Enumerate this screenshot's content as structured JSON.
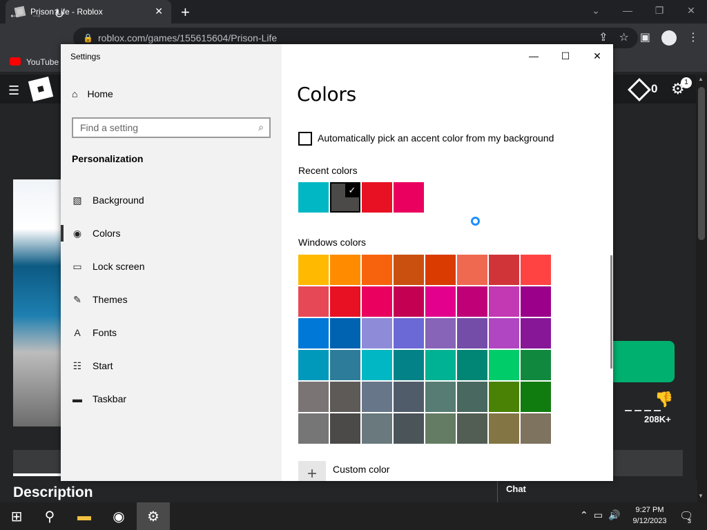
{
  "browser": {
    "tab_title": "Prison Life - Roblox",
    "url": "roblox.com/games/155615604/Prison-Life",
    "bookmark": "YouTube"
  },
  "roblox": {
    "robux": "0",
    "notifications": "1",
    "votes": "208K+",
    "section_title": "Description",
    "chat_label": "Chat"
  },
  "settings": {
    "window_title": "Settings",
    "home_label": "Home",
    "search_placeholder": "Find a setting",
    "section_label": "Personalization",
    "nav_items": [
      {
        "label": "Background",
        "icon": "picture-icon"
      },
      {
        "label": "Colors",
        "icon": "palette-icon"
      },
      {
        "label": "Lock screen",
        "icon": "lock-screen-icon"
      },
      {
        "label": "Themes",
        "icon": "brush-icon"
      },
      {
        "label": "Fonts",
        "icon": "fonts-icon"
      },
      {
        "label": "Start",
        "icon": "start-icon"
      },
      {
        "label": "Taskbar",
        "icon": "taskbar-icon"
      }
    ],
    "page_title": "Colors",
    "auto_accent_label": "Automatically pick an accent color from my background",
    "recent_colors_label": "Recent colors",
    "recent_colors": [
      "#00b7c3",
      "#4c4a48",
      "#e81123",
      "#ea005e"
    ],
    "recent_selected_index": 1,
    "windows_colors_label": "Windows colors",
    "windows_colors": [
      [
        "#ffb900",
        "#ff8c00",
        "#f7630c",
        "#ca5010",
        "#da3b01",
        "#ef6950",
        "#d13438",
        "#ff4343"
      ],
      [
        "#e74856",
        "#e81123",
        "#ea005e",
        "#c30052",
        "#e3008c",
        "#bf0077",
        "#c239b3",
        "#9a0089"
      ],
      [
        "#0078d7",
        "#0063b1",
        "#8e8cd8",
        "#6b69d6",
        "#8764b8",
        "#744da9",
        "#b146c2",
        "#881798"
      ],
      [
        "#0099bc",
        "#2d7d9a",
        "#00b7c3",
        "#038387",
        "#00b294",
        "#018574",
        "#00cc6a",
        "#10893e"
      ],
      [
        "#7a7574",
        "#5d5a58",
        "#68768a",
        "#515c6b",
        "#567c73",
        "#486860",
        "#498205",
        "#107c10"
      ],
      [
        "#767676",
        "#4c4a48",
        "#69797e",
        "#4a5459",
        "#647c64",
        "#525e54",
        "#847545",
        "#7e735f"
      ]
    ],
    "custom_color_label": "Custom color"
  },
  "taskbar": {
    "time": "9:27 PM",
    "date": "9/12/2023",
    "notification_count": "3"
  }
}
